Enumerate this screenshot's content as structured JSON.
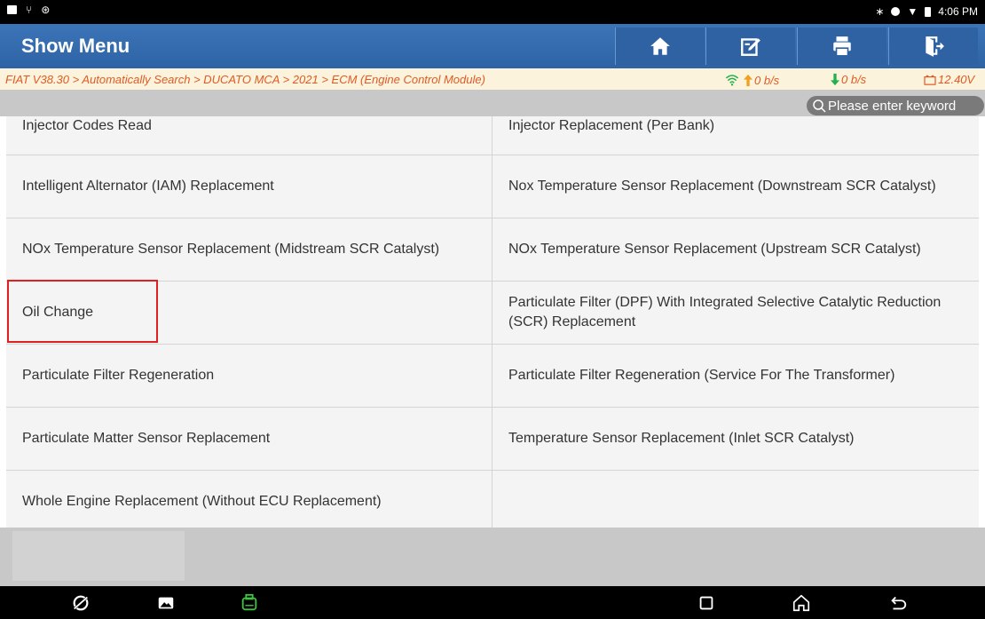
{
  "status_bar": {
    "time": "4:06 PM",
    "left_icons": [
      "image-icon",
      "usb-icon",
      "settings-icon"
    ],
    "right_icons": [
      "bluetooth-icon",
      "circle-icon",
      "wifi-icon",
      "battery-icon"
    ]
  },
  "header": {
    "title": "Show Menu",
    "buttons": [
      "home-icon",
      "edit-icon",
      "print-icon",
      "exit-icon"
    ],
    "accent_color": "#2e64a6"
  },
  "breadcrumb": {
    "path": "FIAT V38.30 > Automatically Search > DUCATO MCA > 2021 > ECM (Engine Control Module)",
    "upload_rate": "0 b/s",
    "download_rate": "0 b/s",
    "voltage": "12.40V"
  },
  "search": {
    "placeholder": "Please enter keyword"
  },
  "menu": {
    "rows": [
      [
        "Injector Codes Read",
        "Injector Replacement (Per Bank)"
      ],
      [
        "Intelligent Alternator (IAM) Replacement",
        "Nox Temperature Sensor Replacement (Downstream SCR Catalyst)"
      ],
      [
        "NOx Temperature Sensor Replacement (Midstream SCR Catalyst)",
        "NOx Temperature Sensor Replacement (Upstream SCR Catalyst)"
      ],
      [
        "Oil Change",
        "Particulate Filter (DPF) With Integrated Selective Catalytic Reduction (SCR) Replacement"
      ],
      [
        "Particulate Filter Regeneration",
        "Particulate Filter Regeneration (Service For The Transformer)"
      ],
      [
        "Particulate Matter Sensor Replacement",
        "Temperature Sensor Replacement (Inlet SCR Catalyst)"
      ],
      [
        "Whole Engine Replacement (Without ECU Replacement)",
        ""
      ]
    ],
    "highlighted_item": "Oil Change",
    "highlight_color": "#e02020"
  },
  "nav_bar": {
    "buttons": [
      "browser-icon",
      "gallery-icon",
      "vci-icon",
      "recents-icon",
      "home-nav-icon",
      "back-icon"
    ]
  }
}
